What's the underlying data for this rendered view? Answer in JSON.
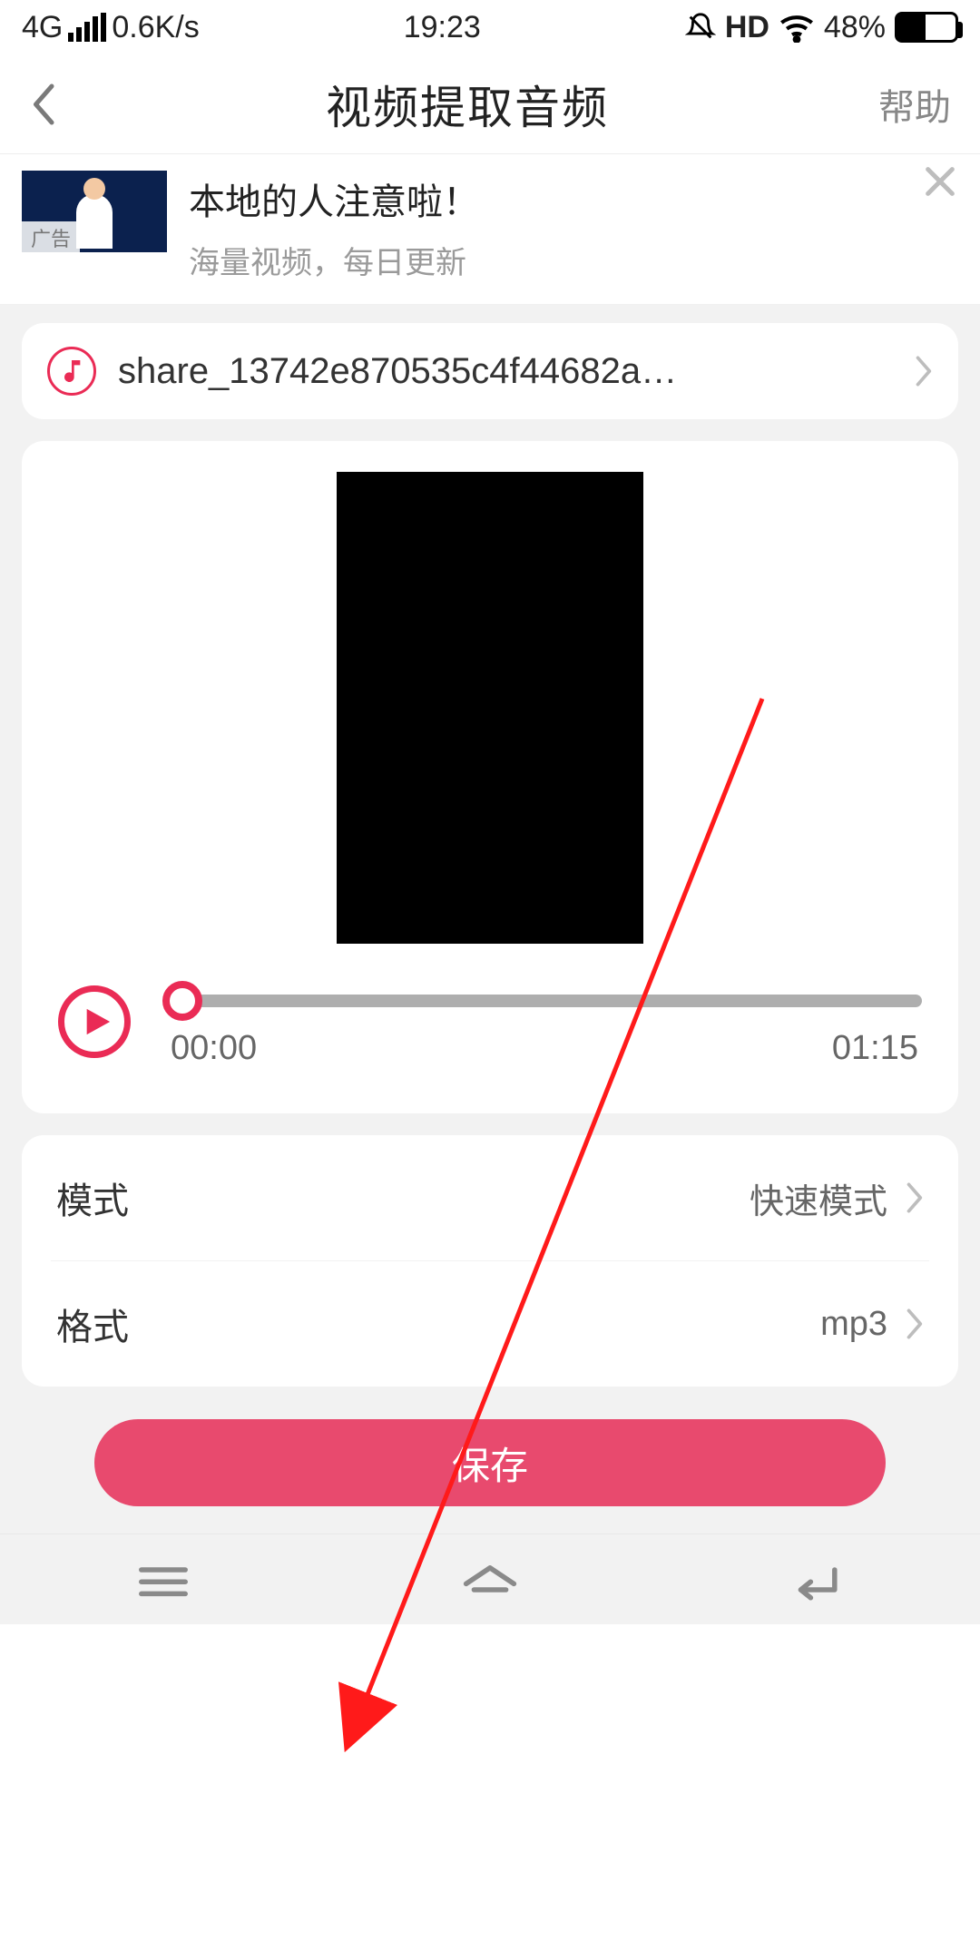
{
  "status": {
    "network": "4G",
    "speed": "0.6K/s",
    "time": "19:23",
    "hd": "HD",
    "battery_pct": "48%"
  },
  "header": {
    "title": "视频提取音频",
    "help": "帮助"
  },
  "ad": {
    "badge": "广告",
    "title": "本地的人注意啦！",
    "subtitle": "海量视频，每日更新"
  },
  "file": {
    "name": "share_13742e870535c4f44682a…"
  },
  "player": {
    "current": "00:00",
    "duration": "01:15"
  },
  "settings": {
    "mode_label": "模式",
    "mode_value": "快速模式",
    "format_label": "格式",
    "format_value": "mp3"
  },
  "actions": {
    "save": "保存"
  },
  "colors": {
    "accent": "#ea2b55",
    "save_btn": "#e84a6e"
  }
}
